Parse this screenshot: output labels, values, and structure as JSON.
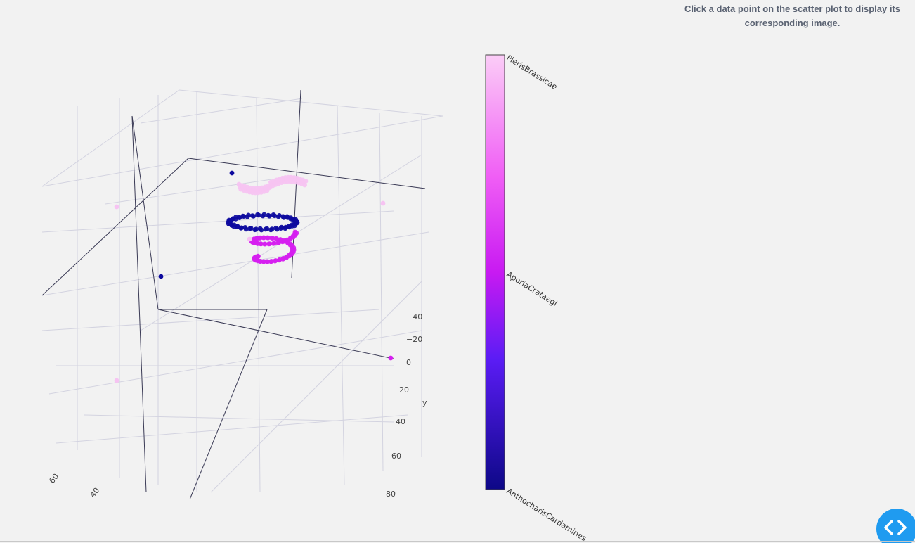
{
  "instructions": {
    "text": "Click a data point on the scatter plot to display its corresponding image."
  },
  "code_toggle": {
    "icon": "code-brackets-icon",
    "color": "#1f9bf0"
  },
  "chart_data": {
    "type": "scatter",
    "dimensions": 3,
    "color_by": "species",
    "categories": [
      "AnthocharisCardamines",
      "AporiaCrataegi",
      "PierisBrassicae"
    ],
    "colorscale": [
      {
        "position": 0,
        "color": "#0d0887"
      },
      {
        "position": 0.5,
        "color": "#d81ff0"
      },
      {
        "position": 1,
        "color": "#fbc9f5"
      }
    ],
    "axes": {
      "y": {
        "label": "y",
        "ticks": [
          "−40",
          "−20",
          "0",
          "20",
          "40",
          "60",
          "80"
        ]
      },
      "x": {
        "ticks": [
          "60",
          "40"
        ]
      }
    },
    "grid": true,
    "series": [
      {
        "name": "AnthocharisCardamines",
        "color": "#0d0a9e"
      },
      {
        "name": "AporiaCrataegi",
        "color": "#d61ff0"
      },
      {
        "name": "PierisBrassicae",
        "color": "#f6c3f2"
      }
    ]
  }
}
